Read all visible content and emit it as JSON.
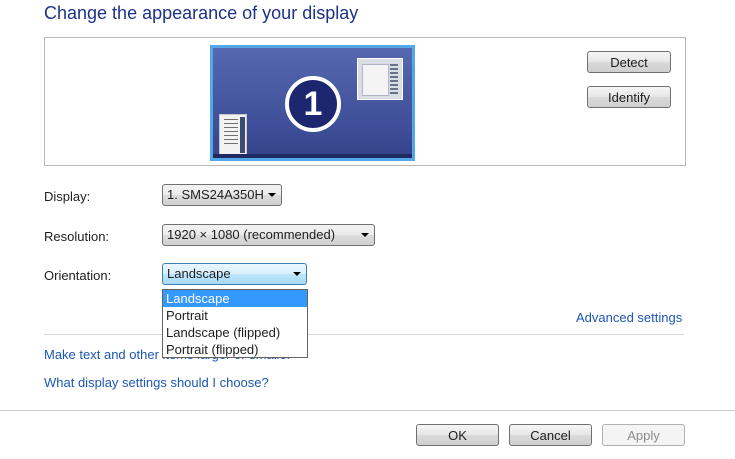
{
  "page": {
    "title": "Change the appearance of your display"
  },
  "preview": {
    "monitor_number": "1",
    "detect_label": "Detect",
    "identify_label": "Identify"
  },
  "settings": {
    "display_label": "Display:",
    "display_value": "1. SMS24A350H",
    "resolution_label": "Resolution:",
    "resolution_value": "1920 × 1080 (recommended)",
    "orientation_label": "Orientation:",
    "orientation_value": "Landscape",
    "orientation_options": [
      "Landscape",
      "Portrait",
      "Landscape (flipped)",
      "Portrait (flipped)"
    ],
    "orientation_selected_index": 0
  },
  "links": {
    "advanced_settings": "Advanced settings",
    "make_text_larger": "Make text and other items larger or smaller",
    "which_settings": "What display settings should I choose?"
  },
  "footer": {
    "ok_label": "OK",
    "cancel_label": "Cancel",
    "apply_label": "Apply"
  },
  "colors": {
    "title": "#1e3287",
    "link": "#1c57b6",
    "selection": "#3399ff"
  }
}
